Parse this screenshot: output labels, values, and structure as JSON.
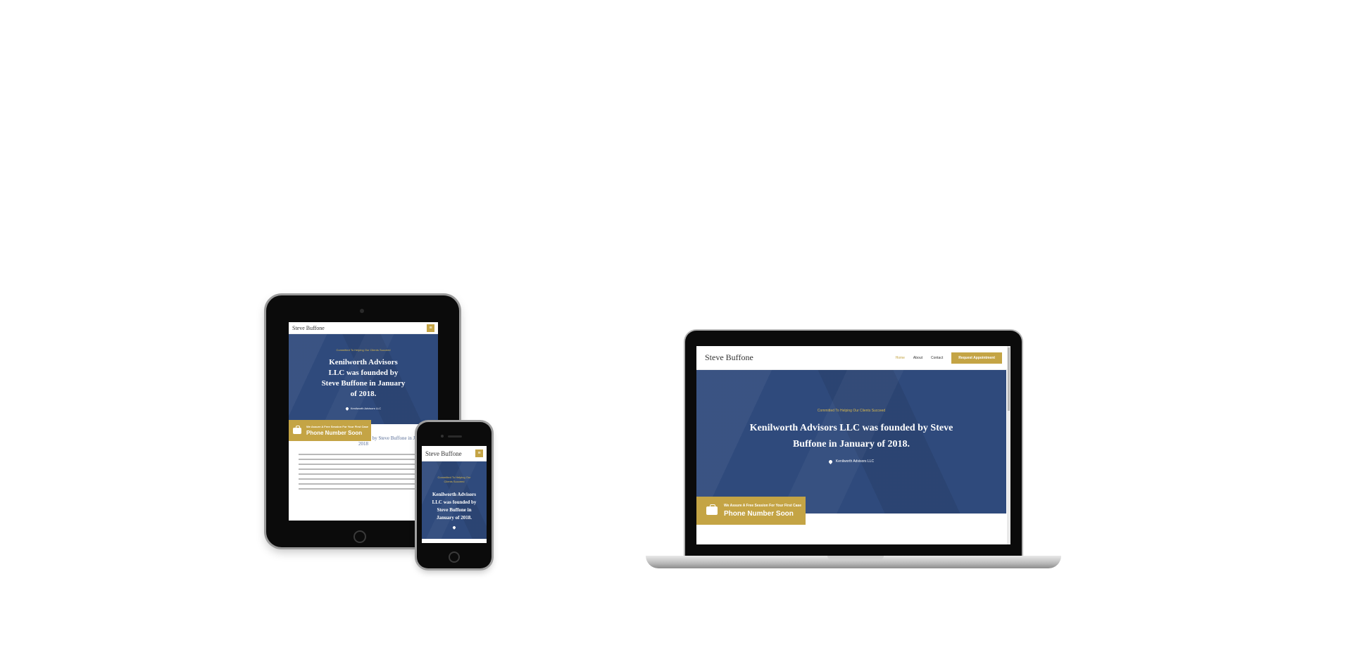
{
  "site": {
    "brand": "Steve Buffone",
    "menu_icon": "hamburger-icon",
    "nav": [
      "Home",
      "About",
      "Contact"
    ],
    "cta": "Request Appointment",
    "hero": {
      "tagline": "Committed To Helping Our Clients Succeed",
      "title": "Kenilworth Advisors LLC was founded by Steve Buffone in January of 2018.",
      "location": "Kenilworth Advisors LLC",
      "location_icon": "map-pin-icon"
    },
    "badge": {
      "icon": "briefcase-icon",
      "small": "We Assure A Free Session For Your First Case",
      "big": "Phone Number Soon"
    },
    "about_title": "Kenilworth Advisors LLC was founded by Steve Buffone in January of 2018"
  },
  "colors": {
    "accent": "#c4a445",
    "hero_bg": "#2f4a7c",
    "tagline": "#d9b84d"
  }
}
